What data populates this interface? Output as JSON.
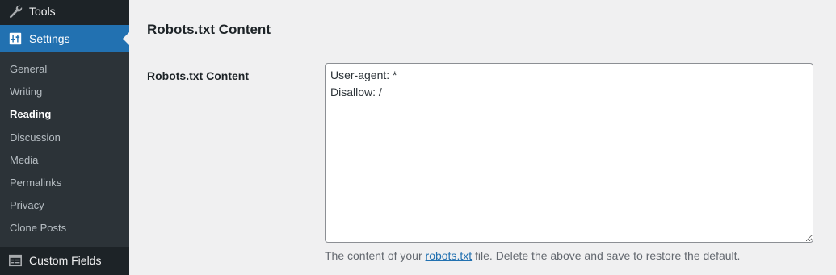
{
  "sidebar": {
    "tools_label": "Tools",
    "settings_label": "Settings",
    "submenu": [
      {
        "label": "General",
        "current": false
      },
      {
        "label": "Writing",
        "current": false
      },
      {
        "label": "Reading",
        "current": true
      },
      {
        "label": "Discussion",
        "current": false
      },
      {
        "label": "Media",
        "current": false
      },
      {
        "label": "Permalinks",
        "current": false
      },
      {
        "label": "Privacy",
        "current": false
      },
      {
        "label": "Clone Posts",
        "current": false
      }
    ],
    "custom_fields_label": "Custom Fields",
    "icons": {
      "tools": "wrench-icon",
      "settings": "settings-sliders-icon",
      "custom_fields": "table-icon"
    }
  },
  "main": {
    "heading": "Robots.txt Content",
    "field_label": "Robots.txt Content",
    "textarea_value": "User-agent: *\nDisallow: /",
    "description_before": "The content of your ",
    "description_link": "robots.txt",
    "description_after": " file. Delete the above and save to restore the default."
  },
  "colors": {
    "sidebar_bg": "#1d2327",
    "submenu_bg": "#2c3338",
    "accent": "#2271b1",
    "page_bg": "#f0f0f1"
  }
}
